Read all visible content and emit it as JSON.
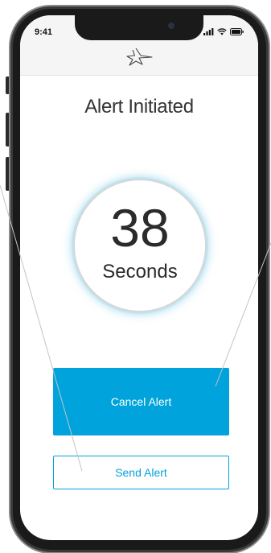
{
  "status_bar": {
    "time": "9:41",
    "icons": [
      "signal-icon",
      "wifi-icon",
      "battery-icon"
    ]
  },
  "header": {
    "logo_icon": "star-logo-icon"
  },
  "main": {
    "title": "Alert Initiated",
    "countdown": {
      "value": "38",
      "unit": "Seconds"
    },
    "cancel_label": "Cancel Alert",
    "send_label": "Send Alert"
  },
  "colors": {
    "accent": "#00a3db",
    "text": "#333333",
    "ring_glow": "#bfe6f2"
  }
}
